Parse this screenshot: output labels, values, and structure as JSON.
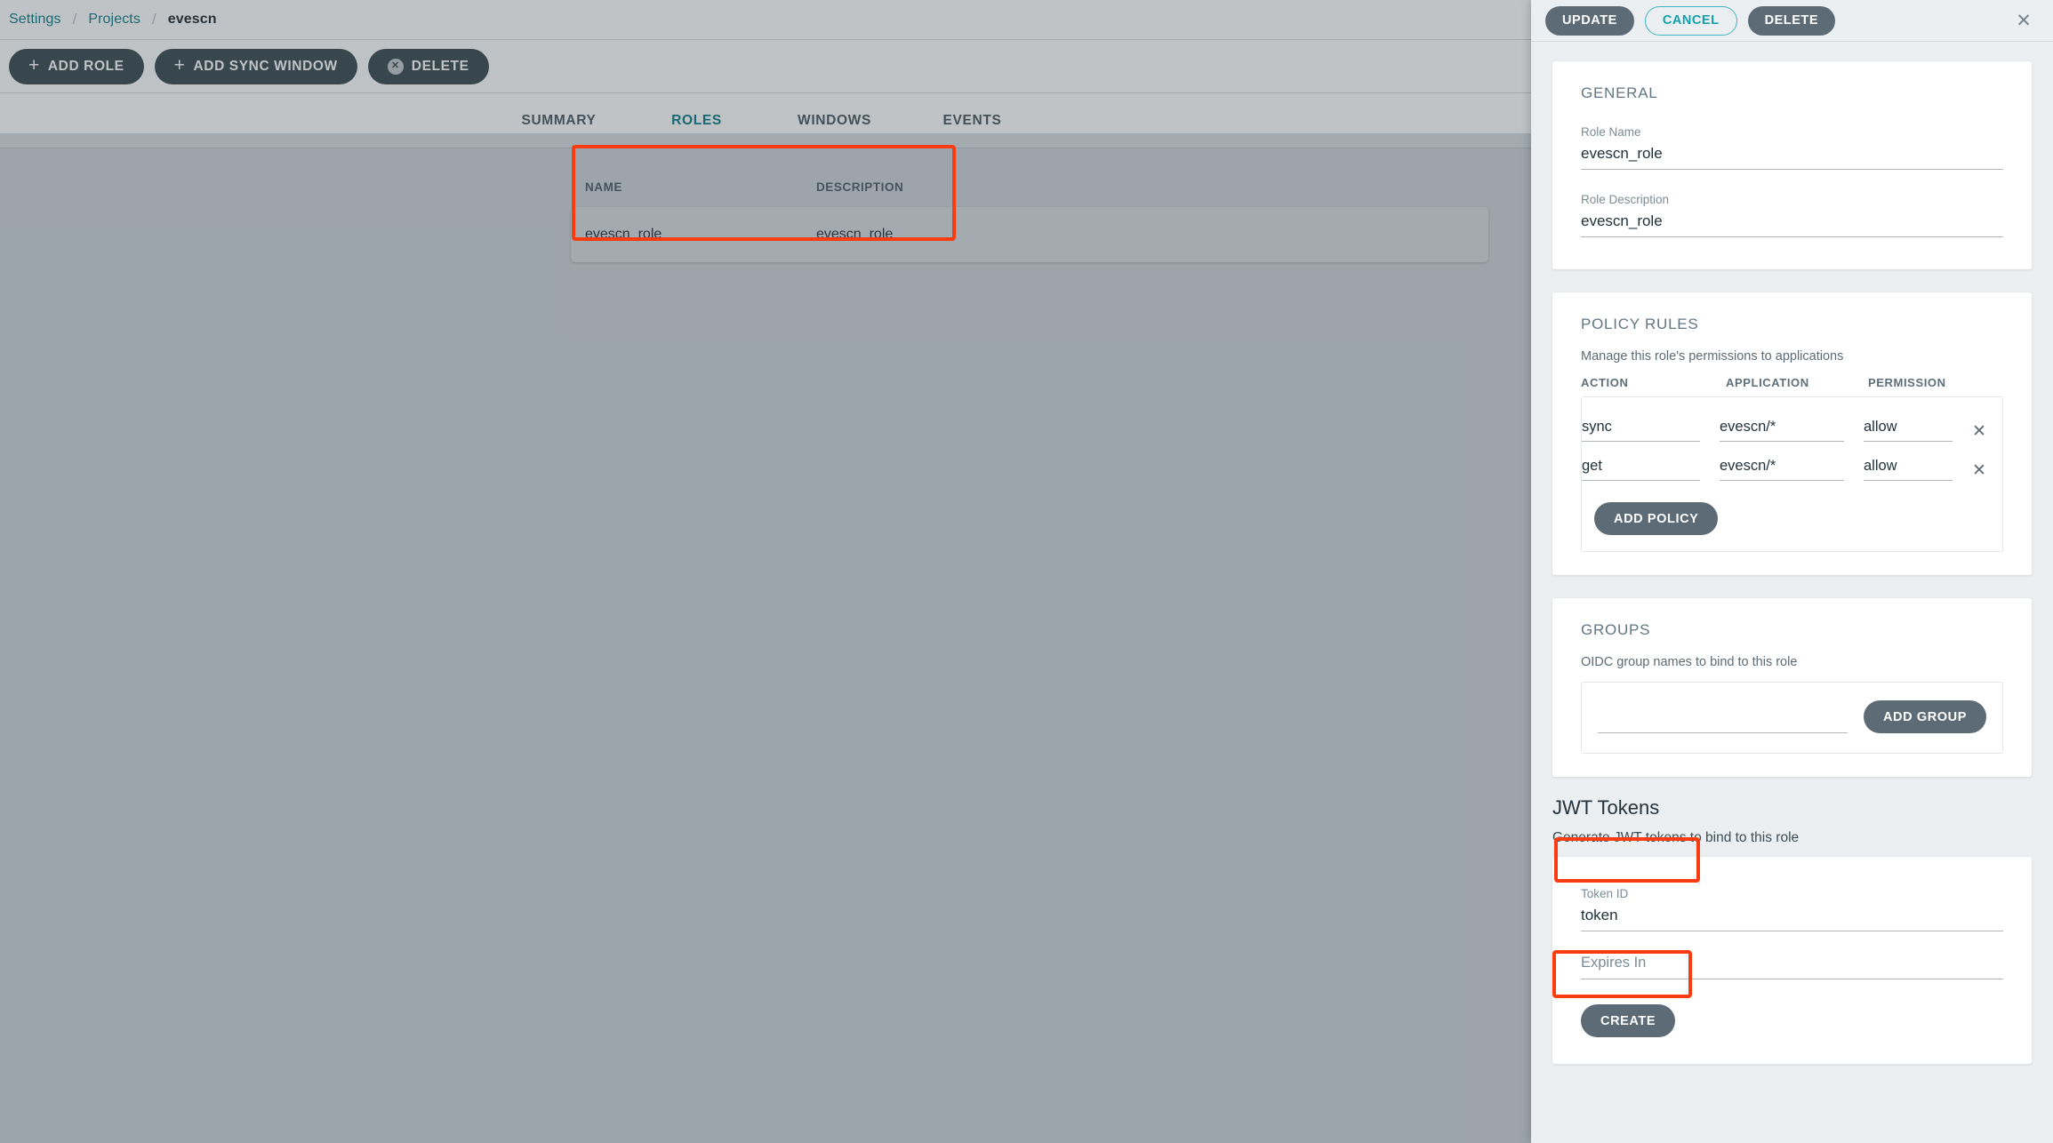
{
  "breadcrumb": {
    "items": [
      "Settings",
      "Projects"
    ],
    "current": "evescn",
    "separator": "/"
  },
  "action_bar": {
    "add_role": "ADD ROLE",
    "add_sync_window": "ADD SYNC WINDOW",
    "delete": "DELETE",
    "plus_glyph": "+",
    "delete_icon_glyph": "✕"
  },
  "tabs": [
    {
      "label": "SUMMARY",
      "active": false
    },
    {
      "label": "ROLES",
      "active": true
    },
    {
      "label": "WINDOWS",
      "active": false
    },
    {
      "label": "EVENTS",
      "active": false
    }
  ],
  "roles_table": {
    "columns": [
      "NAME",
      "DESCRIPTION"
    ],
    "rows": [
      {
        "name": "evescn_role",
        "description": "evescn_role"
      }
    ]
  },
  "panel": {
    "header": {
      "update": "UPDATE",
      "cancel": "CANCEL",
      "delete": "DELETE",
      "close_glyph": "✕"
    },
    "general": {
      "title": "GENERAL",
      "role_name_label": "Role Name",
      "role_name_value": "evescn_role",
      "role_description_label": "Role Description",
      "role_description_value": "evescn_role"
    },
    "policy_rules": {
      "title": "POLICY RULES",
      "subtitle": "Manage this role's permissions to applications",
      "columns": [
        "ACTION",
        "APPLICATION",
        "PERMISSION"
      ],
      "rows": [
        {
          "action": "sync",
          "application": "evescn/*",
          "permission": "allow",
          "remove_glyph": "✕"
        },
        {
          "action": "get",
          "application": "evescn/*",
          "permission": "allow",
          "remove_glyph": "✕"
        }
      ],
      "add_policy": "ADD POLICY"
    },
    "groups": {
      "title": "GROUPS",
      "subtitle": "OIDC group names to bind to this role",
      "input_value": "",
      "add_group": "ADD GROUP"
    },
    "jwt": {
      "title": "JWT Tokens",
      "subtitle": "Generate JWT tokens to bind to this role",
      "token_id_label": "Token ID",
      "token_id_value": "token",
      "expires_in_label": "Expires In",
      "expires_in_value": "",
      "create": "CREATE"
    }
  },
  "colors": {
    "accent_teal": "#0d7d87",
    "button_dark": "#5c6b75",
    "annotation_red": "#fa3c10",
    "panel_bg": "#eceff1"
  }
}
